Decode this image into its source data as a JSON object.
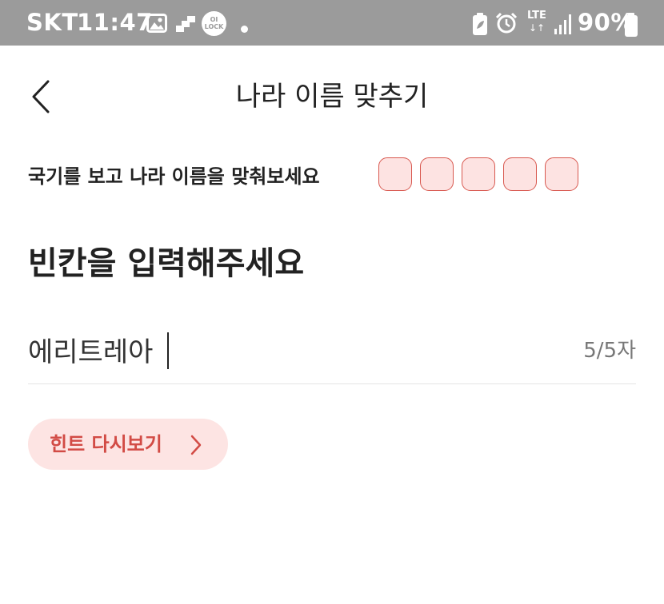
{
  "status_bar": {
    "carrier": "SKT",
    "time": "11:47",
    "lock_badge_line1": "OI",
    "lock_badge_line2": "LOCK",
    "network": "LTE",
    "battery": "90%",
    "icons": [
      "gallery-icon",
      "app-notification-icon",
      "lock-app-icon",
      "dot-icon",
      "battery-saver-icon",
      "alarm-icon",
      "lte-icon",
      "signal-icon",
      "battery-icon"
    ]
  },
  "app_bar": {
    "title": "나라 이름 맞추기",
    "back_icon": "chevron-left-icon"
  },
  "quiz": {
    "prompt": "국기를 보고 나라 이름을 맞춰보세요",
    "blank_count": 5,
    "heading": "빈칸을 입력해주세요",
    "answer_value": "에리트레아",
    "char_counter": "5/5자"
  },
  "hint": {
    "label": "힌트 다시보기",
    "icon": "chevron-right-icon"
  },
  "colors": {
    "status_bar_bg": "#9b9b9b",
    "accent": "#d24b45",
    "accent_soft": "#fde4e3",
    "text": "#222222"
  }
}
